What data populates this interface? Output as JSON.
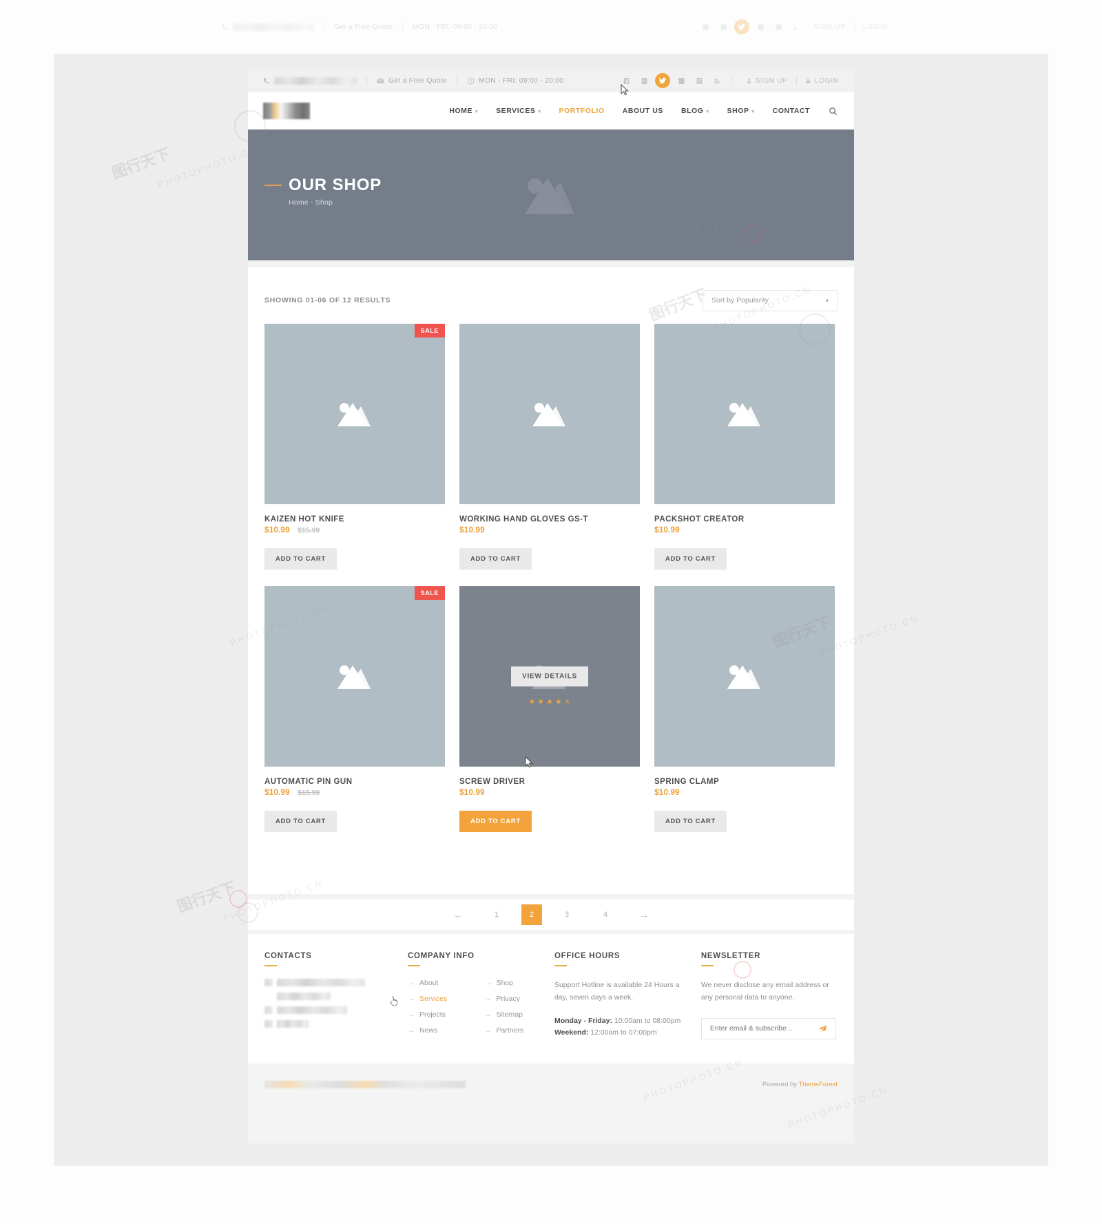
{
  "topbar": {
    "phone_masked": "",
    "quote_label": "Get a Free Quote",
    "hours_label": "MON - FRI: 09:00 - 20:00",
    "signup_label": "SIGN UP",
    "login_label": "LOGIN",
    "social": [
      {
        "name": "facebook-icon",
        "active": false
      },
      {
        "name": "pinterest-icon",
        "active": false
      },
      {
        "name": "twitter-icon",
        "active": true
      },
      {
        "name": "vimeo-icon",
        "active": false
      },
      {
        "name": "instagram-icon",
        "active": false
      },
      {
        "name": "rss-icon",
        "active": false
      }
    ]
  },
  "nav": {
    "items": [
      {
        "label": "HOME",
        "caret": true,
        "active": false
      },
      {
        "label": "SERVICES",
        "caret": true,
        "active": false
      },
      {
        "label": "PORTFOLIO",
        "caret": false,
        "active": true
      },
      {
        "label": "ABOUT US",
        "caret": false,
        "active": false
      },
      {
        "label": "BLOG",
        "caret": true,
        "active": false
      },
      {
        "label": "SHOP",
        "caret": true,
        "active": false
      },
      {
        "label": "CONTACT",
        "caret": false,
        "active": false
      }
    ],
    "search_icon": "search-icon"
  },
  "hero": {
    "title": "OUR SHOP",
    "breadcrumb": "Home - Shop"
  },
  "shop": {
    "result_count": "SHOWING 01-06 OF 12 RESULTS",
    "sort_value": "Sort by Popularity",
    "add_to_cart_label": "ADD TO CART",
    "sale_label": "SALE",
    "view_details_label": "VIEW DETAILS",
    "products": [
      {
        "title": "KAIZEN HOT KNIFE",
        "price": "$10.99",
        "old_price": "$15.99",
        "sale": true,
        "hovered": false,
        "cta_primary": false
      },
      {
        "title": "WORKING HAND GLOVES GS-T",
        "price": "$10.99",
        "old_price": "",
        "sale": false,
        "hovered": false,
        "cta_primary": false
      },
      {
        "title": "PACKSHOT CREATOR",
        "price": "$10.99",
        "old_price": "",
        "sale": false,
        "hovered": false,
        "cta_primary": false
      },
      {
        "title": "AUTOMATIC PIN GUN",
        "price": "$10.99",
        "old_price": "$15.99",
        "sale": true,
        "hovered": false,
        "cta_primary": false
      },
      {
        "title": "SCREW DRIVER",
        "price": "$10.99",
        "old_price": "",
        "sale": false,
        "hovered": true,
        "cta_primary": true,
        "rating": 4.5
      },
      {
        "title": "SPRING CLAMP",
        "price": "$10.99",
        "old_price": "",
        "sale": false,
        "hovered": false,
        "cta_primary": false
      }
    ]
  },
  "pagination": {
    "prev": "←",
    "next": "→",
    "pages": [
      "1",
      "2",
      "3",
      "4"
    ],
    "active": "2"
  },
  "footer": {
    "contacts": {
      "heading": "CONTACTS"
    },
    "company": {
      "heading": "COMPANY INFO",
      "links": [
        {
          "label": "About",
          "highlight": false
        },
        {
          "label": "Shop",
          "highlight": false
        },
        {
          "label": "Services",
          "highlight": true
        },
        {
          "label": "Privacy",
          "highlight": false
        },
        {
          "label": "Projects",
          "highlight": false
        },
        {
          "label": "Sitemap",
          "highlight": false
        },
        {
          "label": "News",
          "highlight": false
        },
        {
          "label": "Partners",
          "highlight": false
        }
      ]
    },
    "office": {
      "heading": "OFFICE HOURS",
      "text": "Support Hotline is available 24 Hours a day, seven days a week.",
      "weekday_label": "Monday - Friday:",
      "weekday_value": "10:00am to 08:00pm",
      "weekend_label": "Weekend:",
      "weekend_value": "12:00am to 07:00pm"
    },
    "newsletter": {
      "heading": "NEWSLETTER",
      "text": "We never disclose any email address or any personal data to anyone.",
      "placeholder": "Enter email & subscribe ..",
      "send_icon": "send-icon"
    }
  },
  "copyright": {
    "powered_prefix": "Powered by ",
    "powered_brand": "ThemeForest"
  },
  "colors": {
    "accent": "#eda23c",
    "sale": "#f0544f",
    "hero_bg": "#757d8a",
    "thumb_bg": "#b1bdc4",
    "thumb_hover_bg": "#7c838d"
  },
  "watermarks": {
    "site": "PHOTOPHOTO.CN",
    "cn": "图行天下"
  }
}
